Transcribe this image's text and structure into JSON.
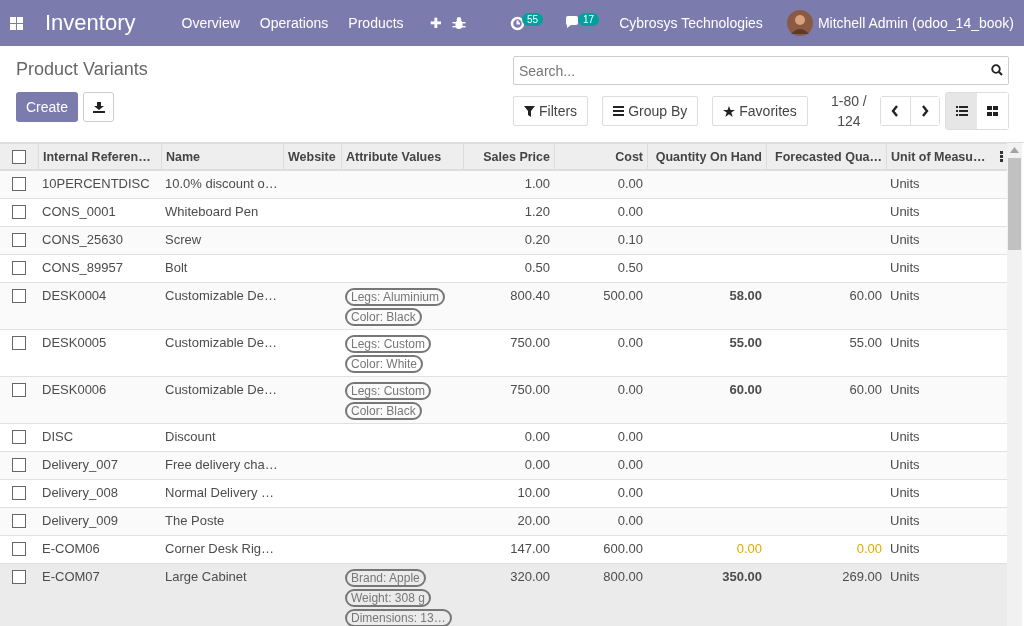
{
  "navbar": {
    "app_title": "Inventory",
    "menu": [
      "Overview",
      "Operations",
      "Products"
    ],
    "plus": "✚",
    "activity_count": "55",
    "message_count": "17",
    "company": "Cybrosys Technologies",
    "user": "Mitchell Admin (odoo_14_book)"
  },
  "page_title": "Product Variants",
  "buttons": {
    "create": "Create"
  },
  "search": {
    "placeholder": "Search..."
  },
  "filters": [
    "Filters",
    "Group By",
    "Favorites"
  ],
  "pager": "1-80 / 124",
  "views": [
    {
      "kind": "list",
      "selected": true
    },
    {
      "kind": "kanban",
      "selected": false
    }
  ],
  "table": {
    "select_all_checked": false,
    "columns": [
      "Internal Referen…",
      "Name",
      "Website",
      "Attribute Values",
      "Sales Price",
      "Cost",
      "Quantity On Hand",
      "Forecasted Qua…",
      "Unit of Measu…"
    ],
    "rows": [
      {
        "ref": "10PERCENTDISC",
        "name": "10.0% discount o…",
        "attributes": [],
        "sales_price": "1.00",
        "cost": "0.00",
        "qty_on_hand": "",
        "forecasted": "",
        "uom": "Units",
        "checked": false,
        "hovered": false
      },
      {
        "ref": "CONS_0001",
        "name": "Whiteboard Pen",
        "attributes": [],
        "sales_price": "1.20",
        "cost": "0.00",
        "qty_on_hand": "",
        "forecasted": "",
        "uom": "Units",
        "checked": false,
        "hovered": false
      },
      {
        "ref": "CONS_25630",
        "name": "Screw",
        "attributes": [],
        "sales_price": "0.20",
        "cost": "0.10",
        "qty_on_hand": "",
        "forecasted": "",
        "uom": "Units",
        "checked": false,
        "hovered": false
      },
      {
        "ref": "CONS_89957",
        "name": "Bolt",
        "attributes": [],
        "sales_price": "0.50",
        "cost": "0.50",
        "qty_on_hand": "",
        "forecasted": "",
        "uom": "Units",
        "checked": false,
        "hovered": false
      },
      {
        "ref": "DESK0004",
        "name": "Customizable De…",
        "attributes": [
          "Legs: Aluminium",
          "Color: Black"
        ],
        "sales_price": "800.40",
        "cost": "500.00",
        "qty_on_hand": "58.00",
        "forecasted": "60.00",
        "uom": "Units",
        "low_stock": false,
        "checked": false,
        "hovered": false
      },
      {
        "ref": "DESK0005",
        "name": "Customizable De…",
        "attributes": [
          "Legs: Custom",
          "Color: White"
        ],
        "sales_price": "750.00",
        "cost": "0.00",
        "qty_on_hand": "55.00",
        "forecasted": "55.00",
        "uom": "Units",
        "low_stock": false,
        "checked": false,
        "hovered": false
      },
      {
        "ref": "DESK0006",
        "name": "Customizable De…",
        "attributes": [
          "Legs: Custom",
          "Color: Black"
        ],
        "sales_price": "750.00",
        "cost": "0.00",
        "qty_on_hand": "60.00",
        "forecasted": "60.00",
        "uom": "Units",
        "low_stock": false,
        "checked": false,
        "hovered": false
      },
      {
        "ref": "DISC",
        "name": "Discount",
        "attributes": [],
        "sales_price": "0.00",
        "cost": "0.00",
        "qty_on_hand": "",
        "forecasted": "",
        "uom": "Units",
        "checked": false,
        "hovered": false
      },
      {
        "ref": "Delivery_007",
        "name": "Free delivery cha…",
        "attributes": [],
        "sales_price": "0.00",
        "cost": "0.00",
        "qty_on_hand": "",
        "forecasted": "",
        "uom": "Units",
        "checked": false,
        "hovered": false
      },
      {
        "ref": "Delivery_008",
        "name": "Normal Delivery …",
        "attributes": [],
        "sales_price": "10.00",
        "cost": "0.00",
        "qty_on_hand": "",
        "forecasted": "",
        "uom": "Units",
        "checked": false,
        "hovered": false
      },
      {
        "ref": "Delivery_009",
        "name": "The Poste",
        "attributes": [],
        "sales_price": "20.00",
        "cost": "0.00",
        "qty_on_hand": "",
        "forecasted": "",
        "uom": "Units",
        "checked": false,
        "hovered": false
      },
      {
        "ref": "E-COM06",
        "name": "Corner Desk Rig…",
        "attributes": [],
        "sales_price": "147.00",
        "cost": "600.00",
        "qty_on_hand": "0.00",
        "forecasted": "0.00",
        "uom": "Units",
        "low_stock": true,
        "checked": false,
        "hovered": false
      },
      {
        "ref": "E-COM07",
        "name": "Large Cabinet",
        "attributes": [
          "Brand: Apple",
          "Weight: 308 g",
          "Dimensions: 13…"
        ],
        "sales_price": "320.00",
        "cost": "800.00",
        "qty_on_hand": "350.00",
        "forecasted": "269.00",
        "uom": "Units",
        "low_stock": false,
        "checked": false,
        "hovered": true
      }
    ]
  }
}
